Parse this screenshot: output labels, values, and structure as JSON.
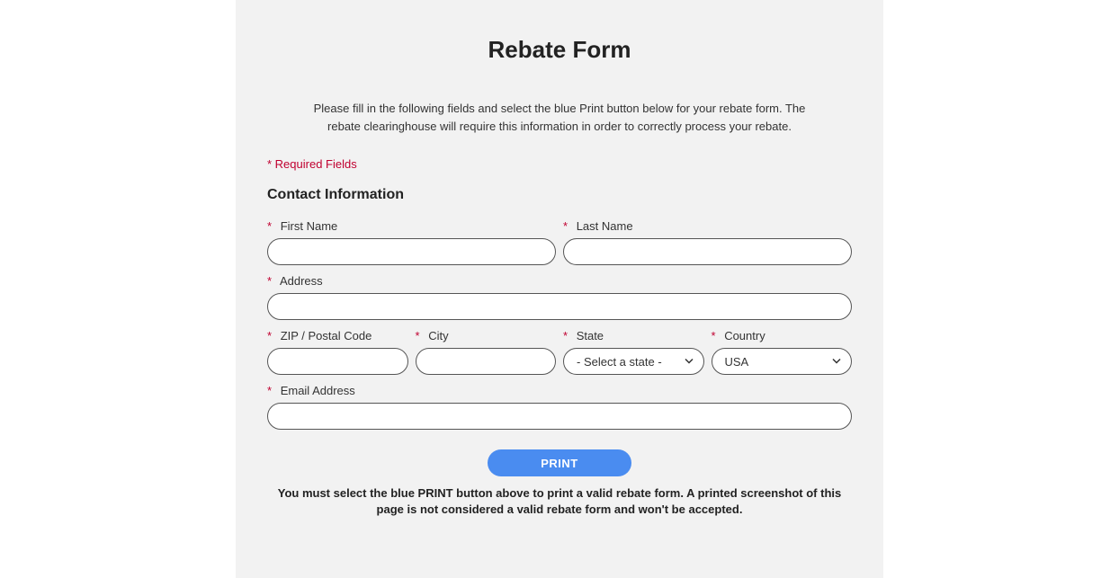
{
  "title": "Rebate Form",
  "intro": "Please fill in the following fields and select the blue Print button below for your rebate form. The rebate clearinghouse will require this information in order to correctly process your rebate.",
  "required_note": "* Required Fields",
  "section_heading": "Contact Information",
  "fields": {
    "first_name": {
      "label": "First Name",
      "value": ""
    },
    "last_name": {
      "label": "Last Name",
      "value": ""
    },
    "address": {
      "label": "Address",
      "value": ""
    },
    "zip": {
      "label": "ZIP / Postal Code",
      "value": ""
    },
    "city": {
      "label": "City",
      "value": ""
    },
    "state": {
      "label": "State",
      "selected": "- Select a state -"
    },
    "country": {
      "label": "Country",
      "selected": "USA"
    },
    "email": {
      "label": "Email Address",
      "value": ""
    }
  },
  "print_button": "PRINT",
  "disclaimer": "You must select the blue PRINT button above to print a valid rebate form. A printed screenshot of this page is not considered a valid rebate form and won't be accepted."
}
